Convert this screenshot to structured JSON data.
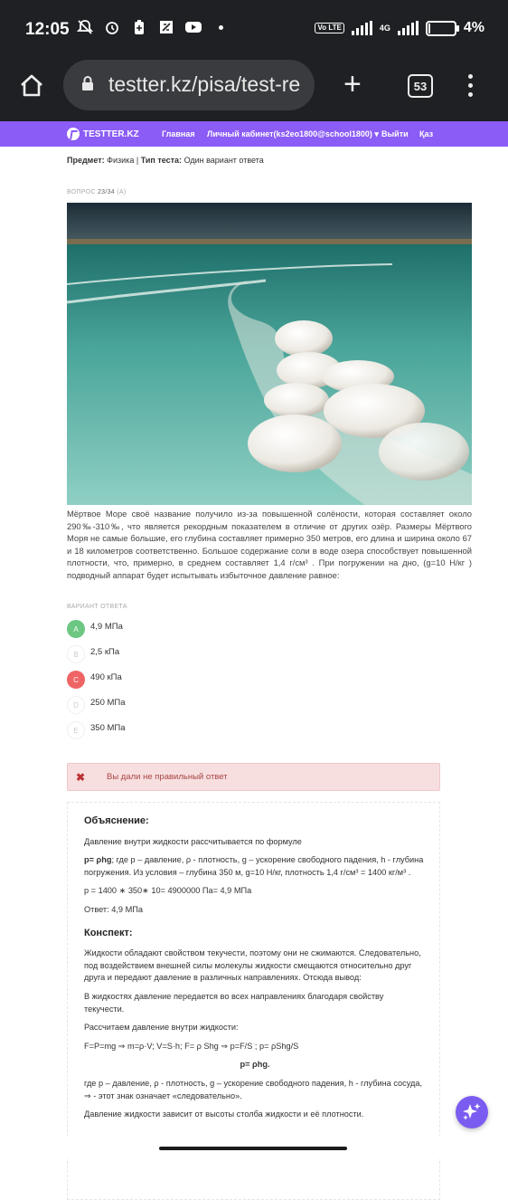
{
  "status": {
    "time": "12:05",
    "volte": "Vo LTE",
    "net": "4G",
    "battery": "4%"
  },
  "browser": {
    "url": "testter.kz/pisa/test-re",
    "tab_count": "53"
  },
  "nav": {
    "logo": "TESTTER.KZ",
    "items": [
      "Главная",
      "Личный кабинет(ks2eo1800@school1800) ▾",
      "Выйти",
      "Қаз"
    ]
  },
  "meta": {
    "subject_label": "Предмет:",
    "subject_value": "Физика",
    "type_label": "Тип теста:",
    "type_value": "Один вариант ответа",
    "question_label": "ВОПРОС",
    "question_number": "23/34",
    "question_suffix": "(А)"
  },
  "question": {
    "text": "Мёртвое Море своё название получило из-за повышенной солёности, которая составляет около 290‰-310‰, что является рекордным показателем в отличие от других озёр. Размеры Мёртвого Моря не самые большие, его глубина составляет примерно 350 метров, его длина и ширина около 67 и 18 километров соответственно. Большое содержание соли в воде озера способствует повышенной плотности, что, примерно, в среднем составляет 1,4 г/см³ . При погружении на дно, (g=10 Н/кг ) подводный аппарат будет испытывать избыточное давление равное:"
  },
  "answers": {
    "label": "ВАРИАНТ ОТВЕТА",
    "options": [
      {
        "letter": "A",
        "text": "4,9 МПа",
        "state": "correct"
      },
      {
        "letter": "B",
        "text": "2,5 кПа",
        "state": "none"
      },
      {
        "letter": "C",
        "text": "490 кПа",
        "state": "wrong"
      },
      {
        "letter": "D",
        "text": "250 МПа",
        "state": "none"
      },
      {
        "letter": "E",
        "text": "350 МПа",
        "state": "none"
      }
    ]
  },
  "result": {
    "message": "Вы дали не правильный ответ"
  },
  "explanation": {
    "title": "Объяснение:",
    "p1": "Давление внутри жидкости рассчитывается по формуле",
    "p2_bold": "p= ρhg",
    "p2_rest": "; где p – давление, ρ - плотность, g – ускорение свободного падения, h - глубина погружения. Из условия – глубина 350 м, g=10 Н/кг, плотность 1,4 г/см³ = 1400 кг/м³ .",
    "p3": "p = 1400 ∗ 350∗ 10= 4900000 Па= 4,9 МПа",
    "p4": "Ответ: 4,9 МПа",
    "title2": "Конспект:",
    "c1": "Жидкости обладают свойством текучести, поэтому они не сжимаются. Следовательно, под воздействием внешней силы молекулы жидкости смещаются относительно друг друга и передают давление в различных направлениях. Отсюда вывод:",
    "c2": "В жидкостях давление передается во всех направлениях благодаря свойству текучести.",
    "c3": "Рассчитаем давление внутри жидкости:",
    "c4": "F=P=mg ⇒ m=ρ·V; V=S·h; F= ρ Shg ⇒ p=F/S ; p= ρShg/S",
    "c5": "p= ρhg.",
    "c6": "где p – давление, ρ - плотность, g – ускорение свободного падения, h - глубина сосуда, ⇒ - этот знак означает «следовательно».",
    "c7": "Давление жидкости зависит от высоты столба жидкости и её плотности."
  }
}
